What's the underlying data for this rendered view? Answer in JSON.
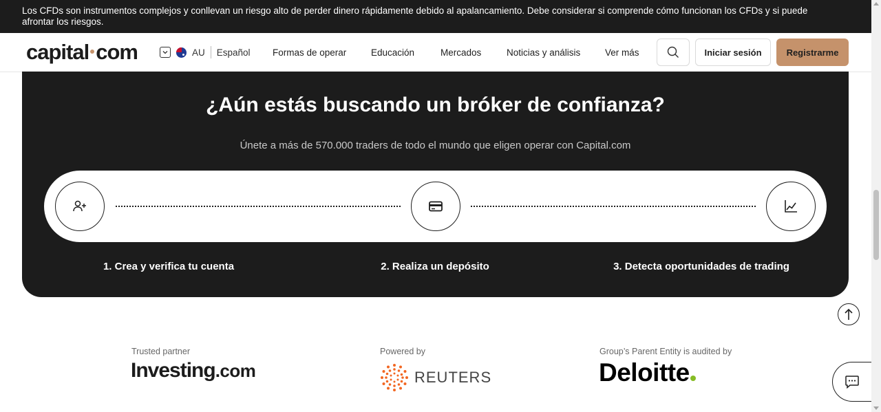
{
  "risk_banner": {
    "text": "Los CFDs son instrumentos complejos y conllevan un riesgo alto de perder dinero rápidamente debido al apalancamiento. Debe considerar si comprende cómo funcionan los CFDs y si puede afrontar los riesgos."
  },
  "header": {
    "logo_left": "capital",
    "logo_right": "com",
    "region_code": "AU",
    "language": "Español",
    "nav": [
      {
        "label": "Formas de operar"
      },
      {
        "label": "Educación"
      },
      {
        "label": "Mercados"
      },
      {
        "label": "Noticias y análisis"
      },
      {
        "label": "Ver más"
      }
    ],
    "search_icon": "search-icon",
    "login_label": "Iniciar sesión",
    "register_label": "Registrarme"
  },
  "promo": {
    "title": "¿Aún estás buscando un bróker de confianza?",
    "subtitle": "Únete a más de 570.000 traders de todo el mundo que eligen operar con Capital.com",
    "steps": [
      {
        "icon": "add-user-icon",
        "label": "1. Crea y verifica tu cuenta"
      },
      {
        "icon": "credit-card-icon",
        "label": "2. Realiza un depósito"
      },
      {
        "icon": "line-chart-icon",
        "label": "3. Detecta oportunidades de trading"
      }
    ]
  },
  "partners": [
    {
      "caption": "Trusted partner",
      "name": "Investing",
      "suffix": ".com"
    },
    {
      "caption": "Powered by",
      "name": "REUTERS"
    },
    {
      "caption": "Group’s Parent Entity is audited by",
      "name": "Deloitte"
    }
  ],
  "colors": {
    "dark": "#1c1c1c",
    "accent": "#c5926b",
    "deloitte_green": "#86bc25",
    "reuters_orange": "#f26722"
  },
  "floating": {
    "scroll_top_icon": "arrow-up-icon",
    "chat_icon": "chat-icon"
  }
}
